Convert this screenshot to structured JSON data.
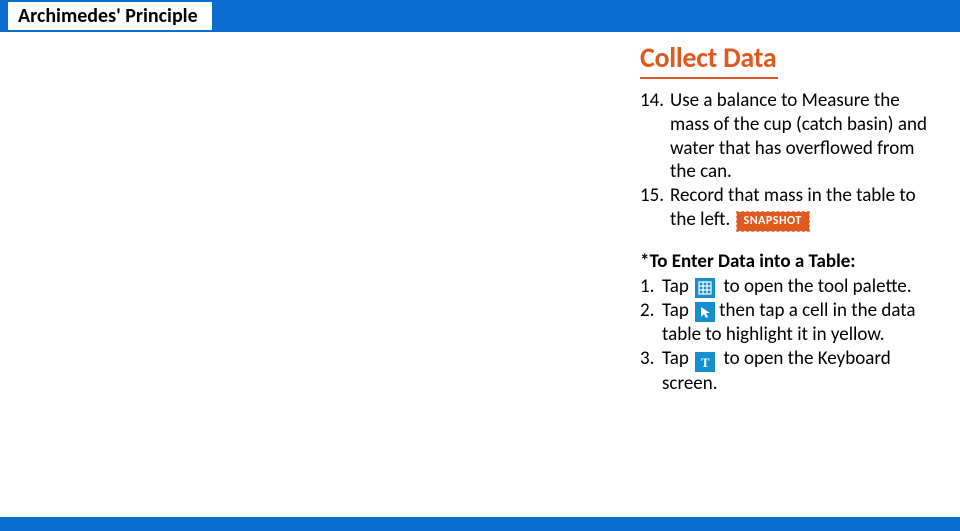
{
  "header": {
    "title": "Archimedes' Principle"
  },
  "section": {
    "heading": "Collect Data"
  },
  "steps": [
    {
      "num": "14.",
      "text": "Use a balance to Measure the mass of the cup (catch basin) and water that has overflowed from the can."
    },
    {
      "num": "15.",
      "text_before": "Record that mass in the table to the left.",
      "badge": "SNAPSHOT"
    }
  ],
  "howto": {
    "heading": "*To Enter Data into a Table:",
    "items": [
      {
        "num": "1.",
        "pre": "Tap ",
        "icon": "grid-icon",
        "post": " to open the tool palette."
      },
      {
        "num": "2.",
        "pre": "Tap ",
        "icon": "cursor-icon",
        "post": "then tap a cell in the data table to highlight it in yellow."
      },
      {
        "num": "3.",
        "pre": "Tap ",
        "icon": "text-icon",
        "icon_letter": "T",
        "post": " to open the Keyboard screen."
      }
    ]
  },
  "colors": {
    "brand_blue": "#0a6ed1",
    "accent_orange": "#e0591f",
    "icon_blue": "#158fce"
  }
}
